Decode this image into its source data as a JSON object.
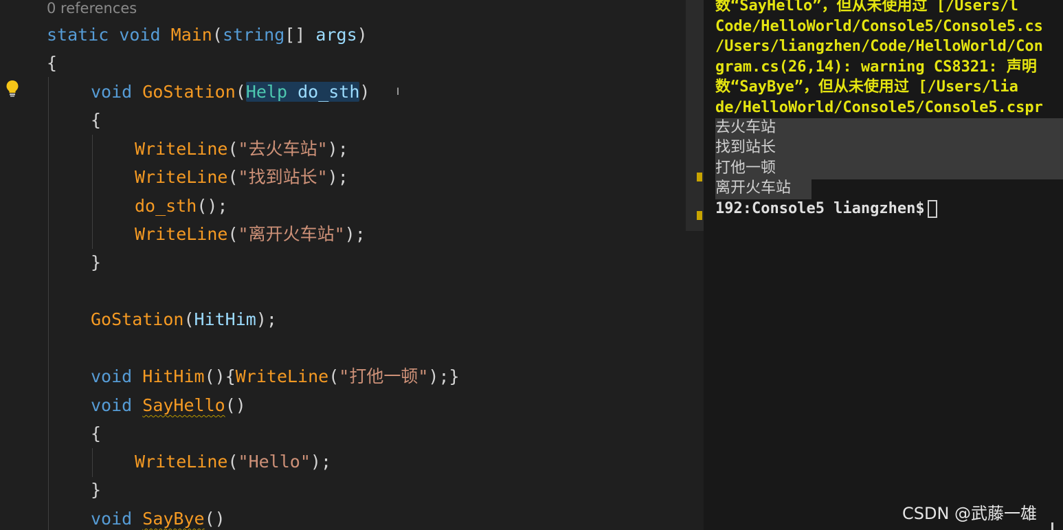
{
  "editor": {
    "codelens": "0 references",
    "lines": {
      "l1": {
        "kw1": "static",
        "kw2": "void",
        "fn": "Main",
        "p1": "(",
        "tp": "string",
        "p2": "[]",
        "var": "args",
        "p3": ")"
      },
      "l2": {
        "p": "{"
      },
      "l3": {
        "kw": "void",
        "fn": "GoStation",
        "p1": "(",
        "tp": "Help",
        "var": "do_sth",
        "p2": ")"
      },
      "l4": {
        "p": "{"
      },
      "l5": {
        "fn": "WriteLine",
        "p1": "(",
        "str": "\"去火车站\"",
        "p2": ");"
      },
      "l6": {
        "fn": "WriteLine",
        "p1": "(",
        "str": "\"找到站长\"",
        "p2": ");"
      },
      "l7": {
        "fn": "do_sth",
        "p1": "();"
      },
      "l8": {
        "fn": "WriteLine",
        "p1": "(",
        "str": "\"离开火车站\"",
        "p2": ");"
      },
      "l9": {
        "p": "}"
      },
      "l10": {
        "fn": "GoStation",
        "p1": "(",
        "var": "HitHim",
        "p2": ");"
      },
      "l11": {
        "kw": "void",
        "fn": "HitHim",
        "p1": "(){",
        "fn2": "WriteLine",
        "p2": "(",
        "str": "\"打他一顿\"",
        "p3": ");}"
      },
      "l12": {
        "kw": "void",
        "fn": "SayHello",
        "p1": "()"
      },
      "l13": {
        "p": "{"
      },
      "l14": {
        "fn": "WriteLine",
        "p1": "(",
        "str": "\"Hello\"",
        "p2": ");"
      },
      "l15": {
        "p": "}"
      },
      "l16": {
        "kw": "void",
        "fn": "SayBye",
        "p1": "()"
      }
    },
    "icons": {
      "lightbulb": "lightbulb-icon",
      "cursor": "text-cursor-icon"
    }
  },
  "terminal": {
    "warnings": [
      "数“SayHello”，但从未使用过 [/Users/l",
      "Code/HelloWorld/Console5/Console5.cs",
      "/Users/liangzhen/Code/HelloWorld/Con",
      "gram.cs(26,14): warning CS8321: 声明",
      "数“SayBye”，但从未使用过 [/Users/lia",
      "de/HelloWorld/Console5/Console5.cspr"
    ],
    "output": [
      "去火车站",
      "找到站长",
      "打他一顿",
      "离开火车站"
    ],
    "prompt": "192:Console5 liangzhen$"
  },
  "watermark": "CSDN @武藤一雄",
  "colors": {
    "background": "#1f1f1f",
    "keyword": "#569cd6",
    "type": "#4ec9b0",
    "function": "#f59a23",
    "string": "#ce9178",
    "variable": "#9cdcfe",
    "warning": "#e5e510"
  }
}
